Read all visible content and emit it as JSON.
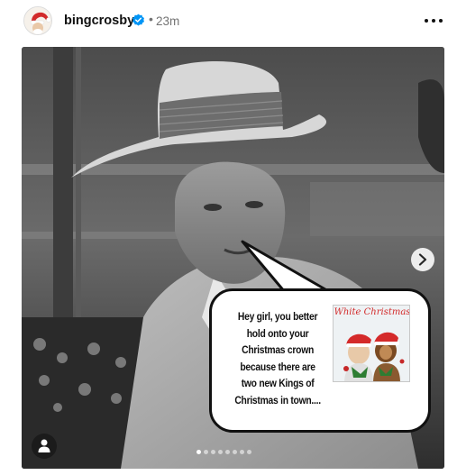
{
  "post": {
    "username": "bingcrosby",
    "verified": true,
    "time_ago": "23m",
    "separator": "•"
  },
  "bubble": {
    "lines": [
      "Hey girl, you better",
      "hold onto your",
      "Christmas crown",
      "because there are",
      "two new Kings of",
      "Christmas in town...."
    ]
  },
  "album": {
    "title": "White Christmas"
  },
  "carousel": {
    "slide_count": 8,
    "active_index": 0
  },
  "icons": {
    "verified": "verified-badge-icon",
    "more": "more-options-icon",
    "next": "chevron-right-icon",
    "tags": "user-tag-icon"
  },
  "colors": {
    "verified_blue": "#0095f6",
    "meta_gray": "#737373"
  }
}
